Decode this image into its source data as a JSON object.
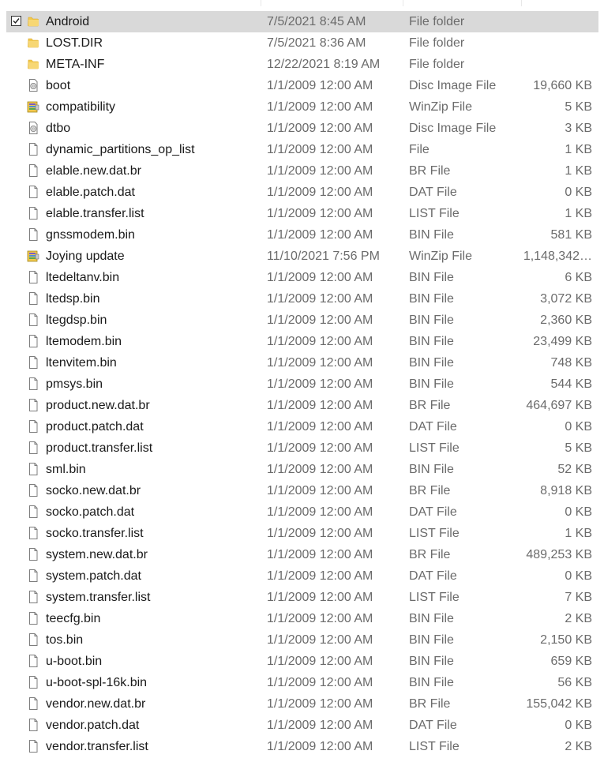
{
  "files": [
    {
      "name": "Android",
      "date": "7/5/2021 8:45 AM",
      "type": "File folder",
      "size": "",
      "icon": "folder-icon",
      "selected": true
    },
    {
      "name": "LOST.DIR",
      "date": "7/5/2021 8:36 AM",
      "type": "File folder",
      "size": "",
      "icon": "folder-icon"
    },
    {
      "name": "META-INF",
      "date": "12/22/2021 8:19 AM",
      "type": "File folder",
      "size": "",
      "icon": "folder-icon"
    },
    {
      "name": "boot",
      "date": "1/1/2009 12:00 AM",
      "type": "Disc Image File",
      "size": "19,660 KB",
      "icon": "disc-image-icon"
    },
    {
      "name": "compatibility",
      "date": "1/1/2009 12:00 AM",
      "type": "WinZip File",
      "size": "5 KB",
      "icon": "zip-archive-icon"
    },
    {
      "name": "dtbo",
      "date": "1/1/2009 12:00 AM",
      "type": "Disc Image File",
      "size": "3 KB",
      "icon": "disc-image-icon"
    },
    {
      "name": "dynamic_partitions_op_list",
      "date": "1/1/2009 12:00 AM",
      "type": "File",
      "size": "1 KB",
      "icon": "file-icon"
    },
    {
      "name": "elable.new.dat.br",
      "date": "1/1/2009 12:00 AM",
      "type": "BR File",
      "size": "1 KB",
      "icon": "file-icon"
    },
    {
      "name": "elable.patch.dat",
      "date": "1/1/2009 12:00 AM",
      "type": "DAT File",
      "size": "0 KB",
      "icon": "file-icon"
    },
    {
      "name": "elable.transfer.list",
      "date": "1/1/2009 12:00 AM",
      "type": "LIST File",
      "size": "1 KB",
      "icon": "file-icon"
    },
    {
      "name": "gnssmodem.bin",
      "date": "1/1/2009 12:00 AM",
      "type": "BIN File",
      "size": "581 KB",
      "icon": "file-icon"
    },
    {
      "name": "Joying update",
      "date": "11/10/2021 7:56 PM",
      "type": "WinZip File",
      "size": "1,148,342…",
      "icon": "zip-archive-icon"
    },
    {
      "name": "ltedeltanv.bin",
      "date": "1/1/2009 12:00 AM",
      "type": "BIN File",
      "size": "6 KB",
      "icon": "file-icon"
    },
    {
      "name": "ltedsp.bin",
      "date": "1/1/2009 12:00 AM",
      "type": "BIN File",
      "size": "3,072 KB",
      "icon": "file-icon"
    },
    {
      "name": "ltegdsp.bin",
      "date": "1/1/2009 12:00 AM",
      "type": "BIN File",
      "size": "2,360 KB",
      "icon": "file-icon"
    },
    {
      "name": "ltemodem.bin",
      "date": "1/1/2009 12:00 AM",
      "type": "BIN File",
      "size": "23,499 KB",
      "icon": "file-icon"
    },
    {
      "name": "ltenvitem.bin",
      "date": "1/1/2009 12:00 AM",
      "type": "BIN File",
      "size": "748 KB",
      "icon": "file-icon"
    },
    {
      "name": "pmsys.bin",
      "date": "1/1/2009 12:00 AM",
      "type": "BIN File",
      "size": "544 KB",
      "icon": "file-icon"
    },
    {
      "name": "product.new.dat.br",
      "date": "1/1/2009 12:00 AM",
      "type": "BR File",
      "size": "464,697 KB",
      "icon": "file-icon"
    },
    {
      "name": "product.patch.dat",
      "date": "1/1/2009 12:00 AM",
      "type": "DAT File",
      "size": "0 KB",
      "icon": "file-icon"
    },
    {
      "name": "product.transfer.list",
      "date": "1/1/2009 12:00 AM",
      "type": "LIST File",
      "size": "5 KB",
      "icon": "file-icon"
    },
    {
      "name": "sml.bin",
      "date": "1/1/2009 12:00 AM",
      "type": "BIN File",
      "size": "52 KB",
      "icon": "file-icon"
    },
    {
      "name": "socko.new.dat.br",
      "date": "1/1/2009 12:00 AM",
      "type": "BR File",
      "size": "8,918 KB",
      "icon": "file-icon"
    },
    {
      "name": "socko.patch.dat",
      "date": "1/1/2009 12:00 AM",
      "type": "DAT File",
      "size": "0 KB",
      "icon": "file-icon"
    },
    {
      "name": "socko.transfer.list",
      "date": "1/1/2009 12:00 AM",
      "type": "LIST File",
      "size": "1 KB",
      "icon": "file-icon"
    },
    {
      "name": "system.new.dat.br",
      "date": "1/1/2009 12:00 AM",
      "type": "BR File",
      "size": "489,253 KB",
      "icon": "file-icon"
    },
    {
      "name": "system.patch.dat",
      "date": "1/1/2009 12:00 AM",
      "type": "DAT File",
      "size": "0 KB",
      "icon": "file-icon"
    },
    {
      "name": "system.transfer.list",
      "date": "1/1/2009 12:00 AM",
      "type": "LIST File",
      "size": "7 KB",
      "icon": "file-icon"
    },
    {
      "name": "teecfg.bin",
      "date": "1/1/2009 12:00 AM",
      "type": "BIN File",
      "size": "2 KB",
      "icon": "file-icon"
    },
    {
      "name": "tos.bin",
      "date": "1/1/2009 12:00 AM",
      "type": "BIN File",
      "size": "2,150 KB",
      "icon": "file-icon"
    },
    {
      "name": "u-boot.bin",
      "date": "1/1/2009 12:00 AM",
      "type": "BIN File",
      "size": "659 KB",
      "icon": "file-icon"
    },
    {
      "name": "u-boot-spl-16k.bin",
      "date": "1/1/2009 12:00 AM",
      "type": "BIN File",
      "size": "56 KB",
      "icon": "file-icon"
    },
    {
      "name": "vendor.new.dat.br",
      "date": "1/1/2009 12:00 AM",
      "type": "BR File",
      "size": "155,042 KB",
      "icon": "file-icon"
    },
    {
      "name": "vendor.patch.dat",
      "date": "1/1/2009 12:00 AM",
      "type": "DAT File",
      "size": "0 KB",
      "icon": "file-icon"
    },
    {
      "name": "vendor.transfer.list",
      "date": "1/1/2009 12:00 AM",
      "type": "LIST File",
      "size": "2 KB",
      "icon": "file-icon"
    }
  ],
  "colors": {
    "selection": "#d9d9d9",
    "folder": "#f2c94c",
    "secondary_text": "#6b6b6b"
  }
}
